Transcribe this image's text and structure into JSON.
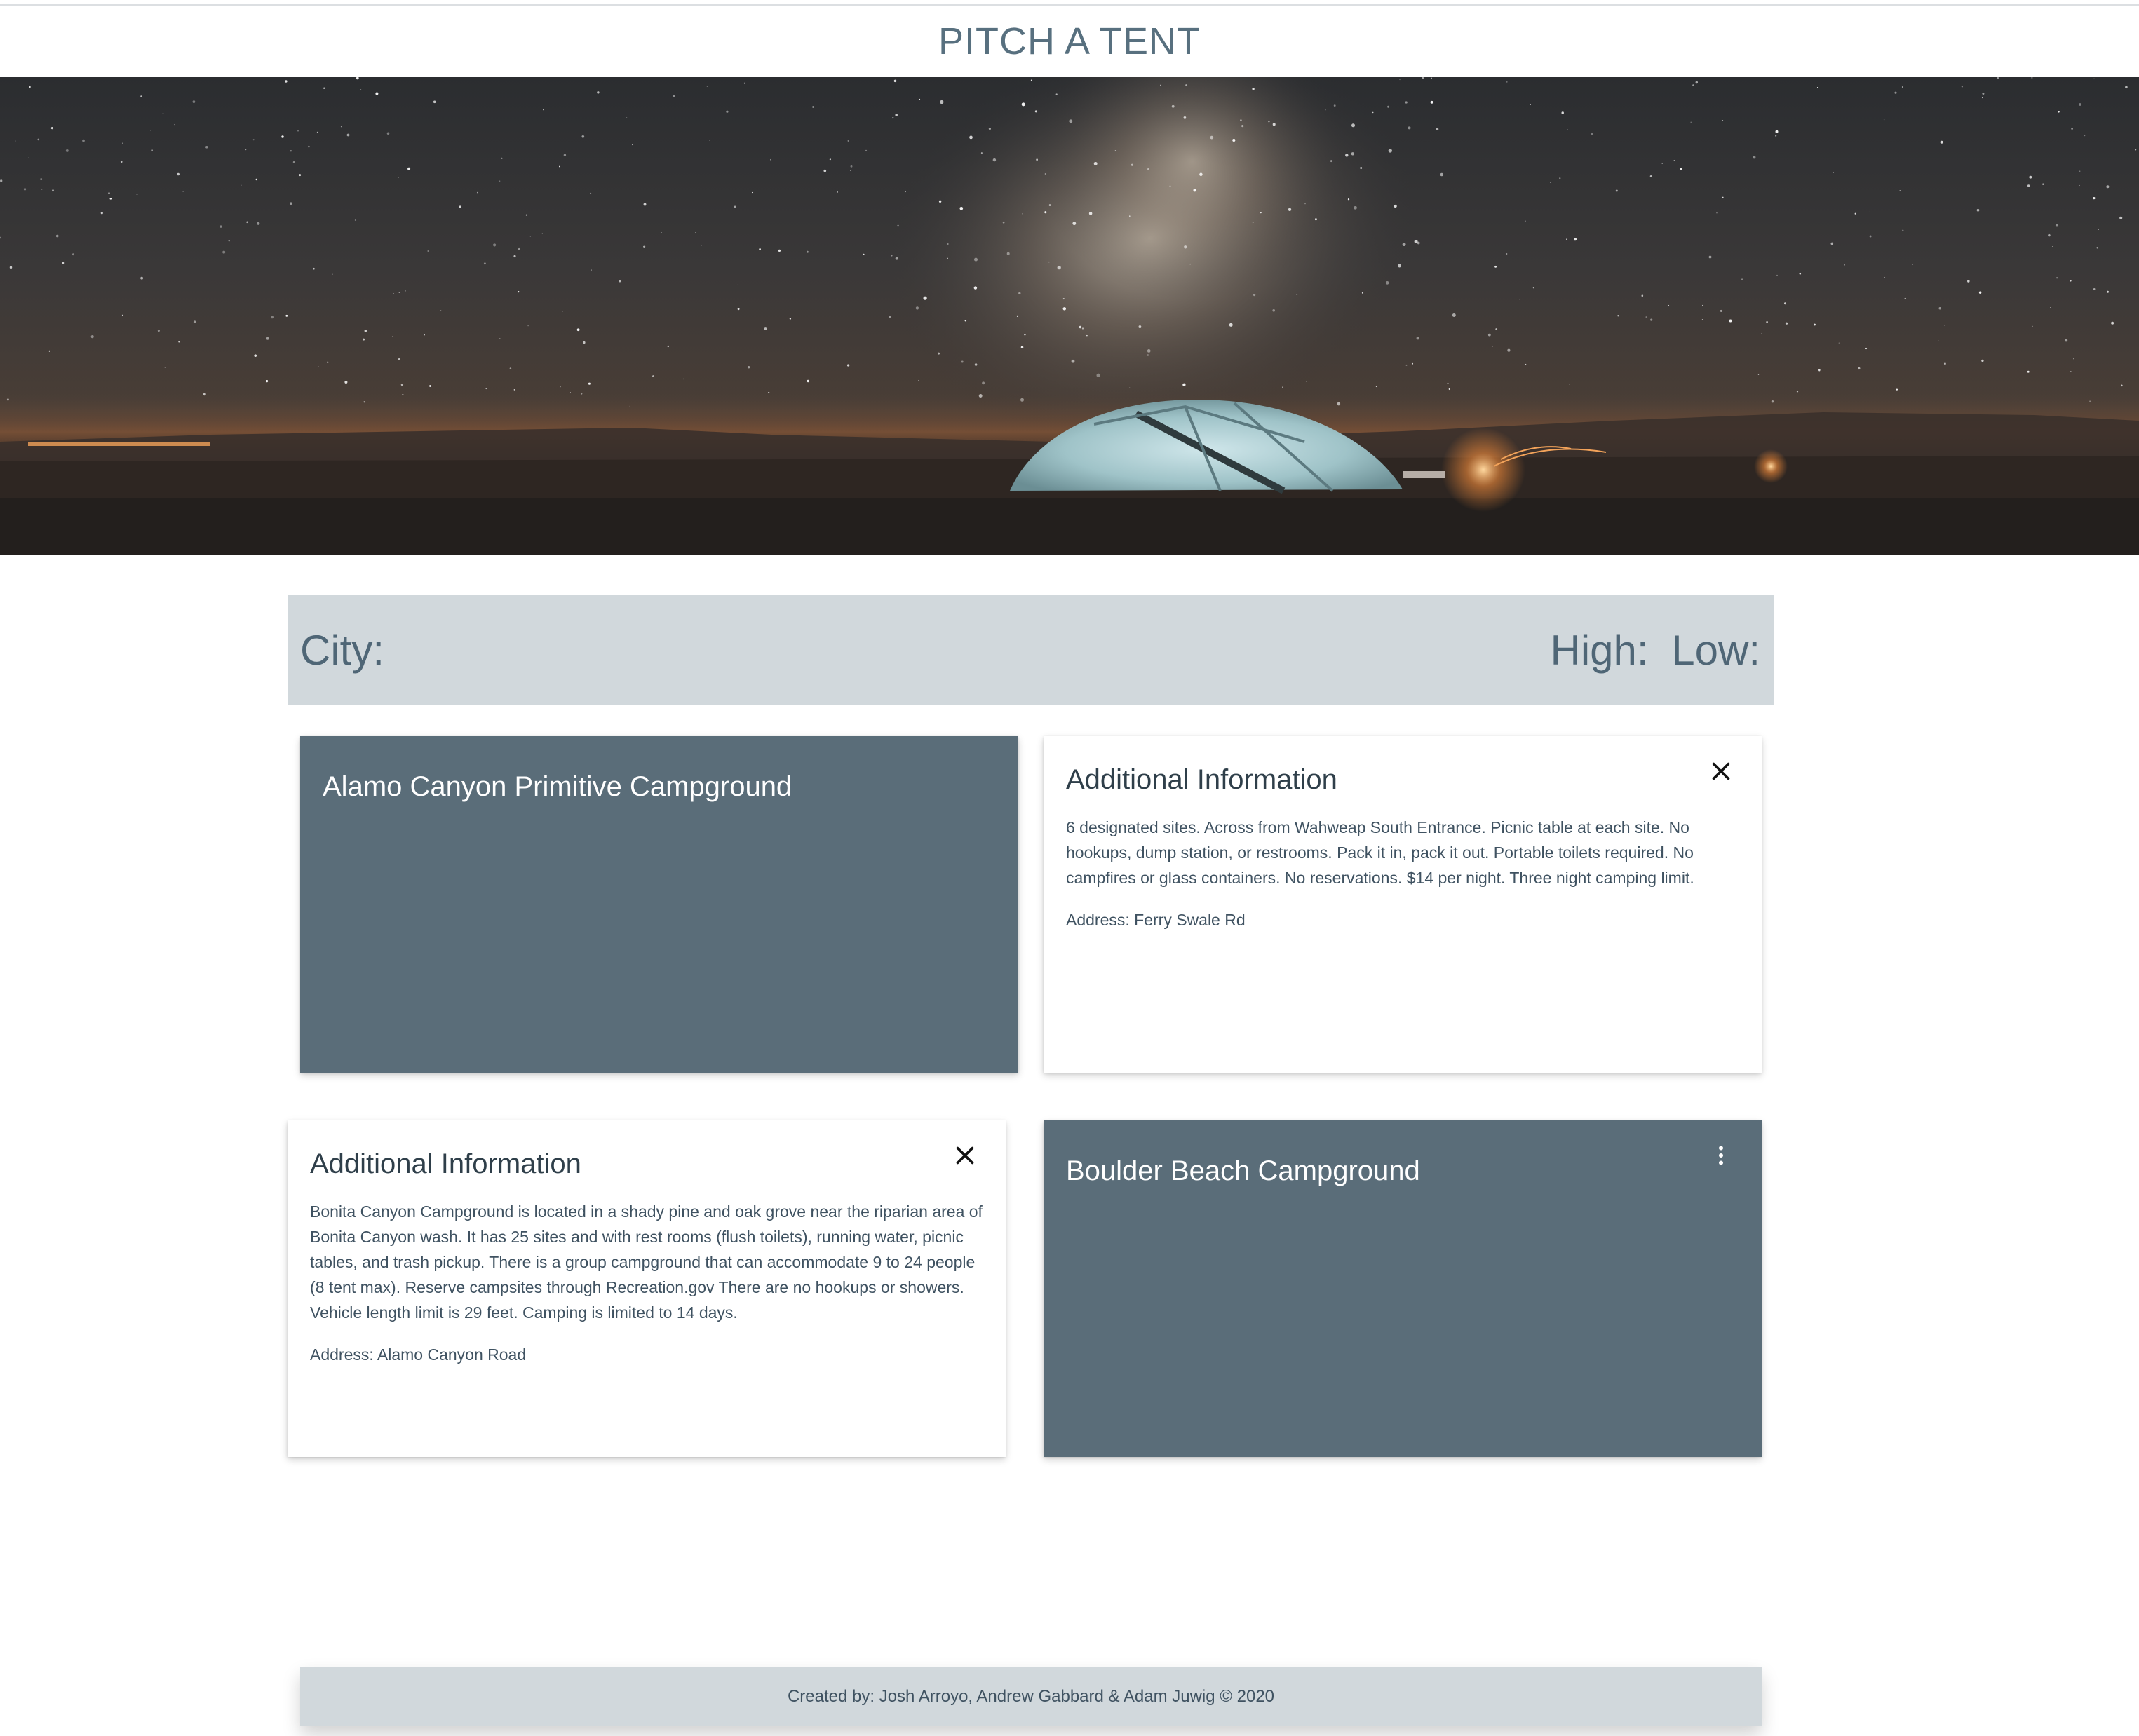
{
  "header": {
    "title": "PITCH A TENT"
  },
  "weather": {
    "city_label": "City:",
    "high_label": "High:",
    "low_label": "Low:"
  },
  "cards": [
    {
      "front_title": "Alamo Canyon Primitive Campground"
    },
    {
      "back_title": "Additional Information",
      "description": "6 designated sites. Across from Wahweap South Entrance. Picnic table at each site. No hookups, dump station, or restrooms. Pack it in, pack it out. Portable toilets required. No campfires or glass containers. No reservations. $14 per night. Three night camping limit.",
      "address": "Address: Ferry Swale Rd"
    },
    {
      "back_title": "Additional Information",
      "description": "Bonita Canyon Campground is located in a shady pine and oak grove near the riparian area of Bonita Canyon wash. It has 25 sites and with rest rooms (flush toilets), running water, picnic tables, and trash pickup. There is a group campground that can accommodate 9 to 24 people (8 tent max). Reserve campsites through Recreation.gov There are no hookups or showers. Vehicle length limit is 29 feet. Camping is limited to 14 days.",
      "address": "Address: Alamo Canyon Road"
    },
    {
      "front_title": "Boulder Beach Campground"
    }
  ],
  "icons": {
    "close": "close-icon",
    "more": "more-vertical-icon"
  },
  "footer": {
    "credits": "Created by: Josh Arroyo, Andrew Gabbard & Adam Juwig © 2020"
  },
  "colors": {
    "title": "#58707f",
    "card_front_bg": "#5a6d79",
    "weather_bar_bg": "#d1d8dc",
    "footer_bg": "#d1d8dc"
  }
}
